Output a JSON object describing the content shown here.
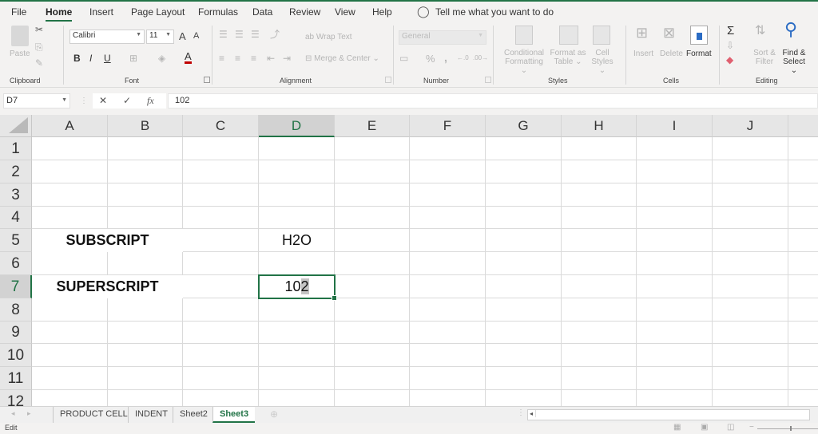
{
  "menu": {
    "tabs": [
      {
        "label": "File"
      },
      {
        "label": "Home",
        "active": true
      },
      {
        "label": "Insert"
      },
      {
        "label": "Page Layout"
      },
      {
        "label": "Formulas"
      },
      {
        "label": "Data"
      },
      {
        "label": "Review"
      },
      {
        "label": "View"
      },
      {
        "label": "Help"
      }
    ],
    "tell_me": "Tell me what you want to do"
  },
  "ribbon": {
    "clipboard": {
      "label": "Clipboard",
      "paste": "Paste"
    },
    "font": {
      "label": "Font",
      "font_name": "Calibri",
      "font_size": "11",
      "bold": "B",
      "italic": "I",
      "underline": "U",
      "grow": "A",
      "shrink": "A",
      "font_color": "A"
    },
    "alignment": {
      "label": "Alignment",
      "wrap_text": "Wrap Text",
      "merge_center": "Merge & Center"
    },
    "number": {
      "label": "Number",
      "format": "General",
      "percent": "%",
      "comma": ","
    },
    "styles": {
      "label": "Styles",
      "conditional_1": "Conditional",
      "conditional_2": "Formatting",
      "format_table_1": "Format as",
      "format_table_2": "Table",
      "cell_styles_1": "Cell",
      "cell_styles_2": "Styles"
    },
    "cells": {
      "label": "Cells",
      "insert": "Insert",
      "delete": "Delete",
      "format": "Format"
    },
    "editing": {
      "label": "Editing",
      "sigma": "Σ",
      "sort_1": "Sort &",
      "sort_2": "Filter",
      "find_1": "Find &",
      "find_2": "Select"
    }
  },
  "formula_bar": {
    "name_box": "D7",
    "cancel": "✕",
    "enter": "✓",
    "fx": "fx",
    "value": "102"
  },
  "grid": {
    "columns": [
      "A",
      "B",
      "C",
      "D",
      "E",
      "F",
      "G",
      "H",
      "I",
      "J"
    ],
    "rows": [
      "1",
      "2",
      "3",
      "4",
      "5",
      "6",
      "7",
      "8",
      "9",
      "10",
      "11",
      "12"
    ],
    "selected_column": "D",
    "selected_row": "7",
    "cells": {
      "A5_B5": "SUBSCRIPT",
      "D5": "H2O",
      "A7_B7": "SUPERSCRIPT",
      "D7_before_cursor": "10",
      "D7_selected": "2"
    }
  },
  "sheet_tabs": [
    {
      "label": "PRODUCT CELL"
    },
    {
      "label": "INDENT"
    },
    {
      "label": "Sheet2"
    },
    {
      "label": "Sheet3",
      "active": true
    }
  ],
  "status": {
    "mode": "Edit"
  }
}
